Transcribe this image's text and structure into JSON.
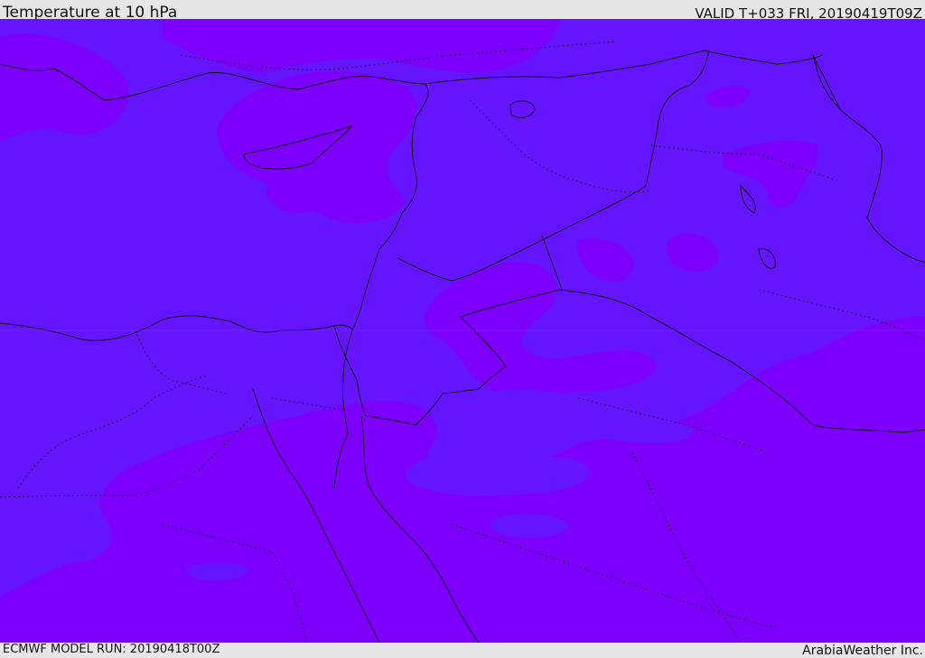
{
  "header": {
    "title": "Temperature at 10 hPa",
    "valid": "VALID T+033 FRI, 20190419T09Z"
  },
  "footer": {
    "model_run": "ECMWF MODEL RUN: 20190418T00Z",
    "brand": "ArabiaWeather Inc."
  },
  "map": {
    "colors": {
      "cool_fill": "#6414ff",
      "warm_fill": "#7d00ff",
      "coastline": "#111111",
      "boundary": "#222222"
    }
  }
}
